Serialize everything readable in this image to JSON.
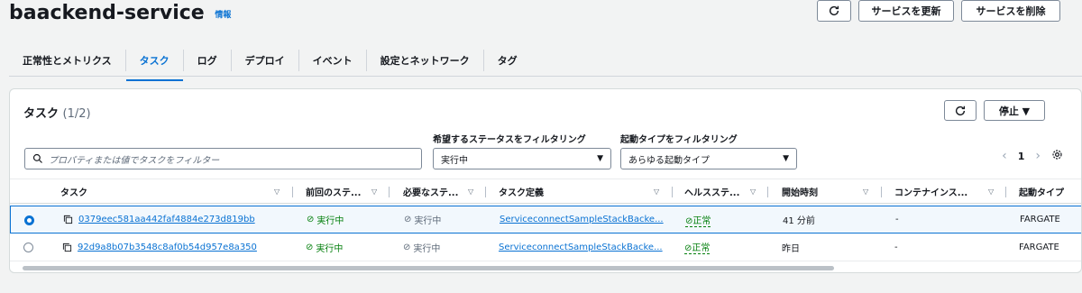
{
  "header": {
    "title": "baackend-service",
    "info": "情報"
  },
  "actions": {
    "update": "サービスを更新",
    "delete": "サービスを削除"
  },
  "tabs": [
    "正常性とメトリクス",
    "タスク",
    "ログ",
    "デプロイ",
    "イベント",
    "設定とネットワーク",
    "タグ"
  ],
  "panel": {
    "title": "タスク",
    "count": "(1/2)",
    "stop": "停止 ▼",
    "status_filter_label": "希望するステータスをフィルタリング",
    "launch_filter_label": "起動タイプをフィルタリング",
    "search_placeholder": "プロパティまたは値でタスクをフィルター",
    "status_value": "実行中",
    "launch_value": "あらゆる起動タイプ",
    "page": "1"
  },
  "columns": [
    "タスク",
    "前回のステ...",
    "必要なステ...",
    "タスク定義",
    "ヘルスステ...",
    "開始時刻",
    "コンテナインス...",
    "起動タイプ"
  ],
  "rows": [
    {
      "task": "0379eec581aa442faf4884e273d819bb",
      "last": "実行中",
      "desired": "実行中",
      "def": "ServiceconnectSampleStackBacke...",
      "health": "正常",
      "started": "41 分前",
      "container": "-",
      "launch": "FARGATE"
    },
    {
      "task": "92d9a8b07b3548c8af0b54d957e8a350",
      "last": "実行中",
      "desired": "実行中",
      "def": "ServiceconnectSampleStackBacke...",
      "health": "正常",
      "started": "昨日",
      "container": "-",
      "launch": "FARGATE"
    }
  ]
}
